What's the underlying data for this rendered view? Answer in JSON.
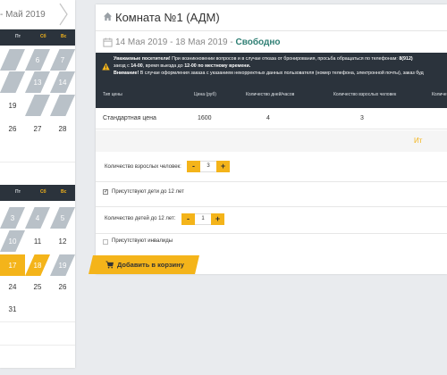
{
  "calendar": {
    "title": "- Май 2019",
    "weekday_headers": [
      "Пт",
      "Сб",
      "Вс"
    ],
    "month1_rows": [
      [
        "",
        "",
        ""
      ],
      [
        "",
        "6",
        "7"
      ],
      [
        "",
        "13",
        "14"
      ],
      [
        "19",
        "",
        ""
      ],
      [
        "26",
        "27",
        "28"
      ]
    ],
    "month2_rows": [
      [
        "3",
        "4",
        "5"
      ],
      [
        "10",
        "11",
        "12"
      ],
      [
        "17",
        "18",
        "19"
      ],
      [
        "24",
        "25",
        "26"
      ],
      [
        "31",
        "",
        ""
      ]
    ]
  },
  "booking": {
    "room_title": "Комната №1 (АДМ)",
    "date_range": "14 Мая 2019 - 18 Мая 2019 -",
    "availability": "Свободно",
    "notice": {
      "line1_bold": "Уважаемые посетители!",
      "line1_text": " При возникновении вопросов и в случае отказа от бронирования, просьба обращаться по телефонам: ",
      "line1_phone": "8(912)",
      "line2_text": "заезд с ",
      "line2_time1": "14-00",
      "line2_mid": ", время выезда до ",
      "line2_time2": "12-00 по местному времени.",
      "line3_bold": "Внимание!",
      "line3_text": " В случае оформления заказа с указанием некорректных данных пользователя (номер телефона, электронной почты), заказ буд"
    },
    "table": {
      "headers": [
        "Тип цены",
        "Цена (руб)",
        "Количество дней/часов",
        "Количество взрослых человек",
        "Количе"
      ],
      "row": [
        "Стандартная цена",
        "1600",
        "4",
        "3",
        ""
      ],
      "total_label": "Ит"
    },
    "adults_label": "Количество взрослых человек:",
    "adults_value": "3",
    "children_present_label": "Присутствуют дети до 12 лет",
    "children_present_checked": true,
    "children_count_label": "Количество детей до 12 лет:",
    "children_value": "1",
    "disabled_label": "Присутствуют инвалиды",
    "disabled_checked": false,
    "minus_label": "-",
    "plus_label": "+",
    "cart_button_label": "Добавить в корзину"
  },
  "colors": {
    "accent": "#f4b41a",
    "dark": "#2b333c",
    "available": "#2f7f74",
    "booked": "#b9c1c8"
  },
  "icons": [
    "chevron-right-icon",
    "home-icon",
    "calendar-icon",
    "warning-icon",
    "cart-icon"
  ]
}
